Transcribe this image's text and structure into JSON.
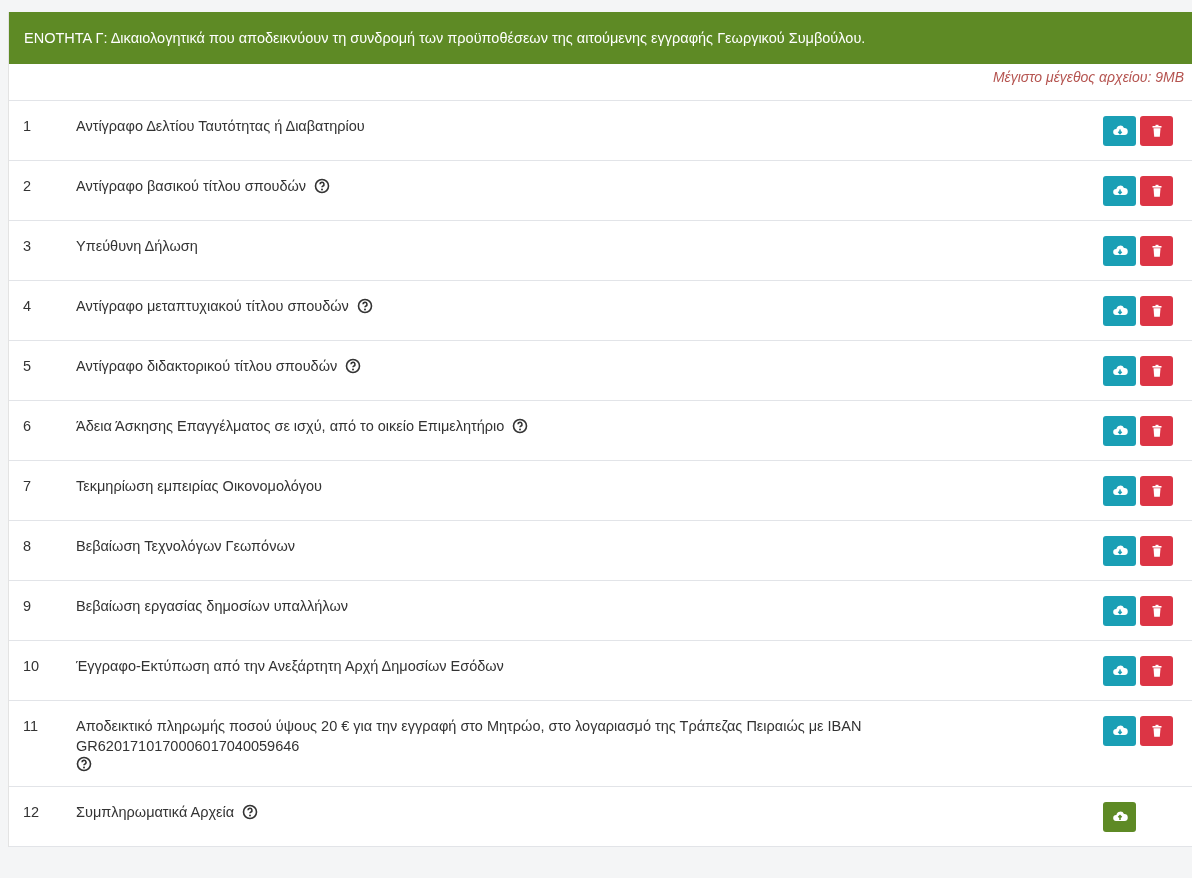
{
  "section": {
    "title": "ΕΝΟΤΗΤΑ Γ: Δικαιολογητικά που αποδεικνύουν τη συνδρομή των προϋποθέσεων της αιτούμενης εγγραφής Γεωργικού Συμβούλου.",
    "max_size_note": "Μέγιστο μέγεθος αρχείου: 9MB"
  },
  "documents": [
    {
      "number": "1",
      "label": "Αντίγραφο Δελτίου Ταυτότητας ή Διαβατηρίου",
      "help": false,
      "kind": "document"
    },
    {
      "number": "2",
      "label": "Αντίγραφο βασικού τίτλου σπουδών",
      "help": true,
      "kind": "document"
    },
    {
      "number": "3",
      "label": "Υπεύθυνη Δήλωση",
      "help": false,
      "kind": "document"
    },
    {
      "number": "4",
      "label": "Αντίγραφο μεταπτυχιακού τίτλου σπουδών",
      "help": true,
      "kind": "document"
    },
    {
      "number": "5",
      "label": "Αντίγραφο διδακτορικού τίτλου σπουδών",
      "help": true,
      "kind": "document"
    },
    {
      "number": "6",
      "label": "Άδεια Άσκησης Επαγγέλματος σε ισχύ, από το οικείο Επιμελητήριο",
      "help": true,
      "kind": "document"
    },
    {
      "number": "7",
      "label": "Τεκμηρίωση εμπειρίας Οικονομολόγου",
      "help": false,
      "kind": "document"
    },
    {
      "number": "8",
      "label": "Βεβαίωση Τεχνολόγων Γεωπόνων",
      "help": false,
      "kind": "document"
    },
    {
      "number": "9",
      "label": "Βεβαίωση εργασίας δημοσίων υπαλλήλων",
      "help": false,
      "kind": "document"
    },
    {
      "number": "10",
      "label": "Έγγραφο-Εκτύπωση από την Ανεξάρτητη Αρχή Δημοσίων Εσόδων",
      "help": false,
      "kind": "document"
    },
    {
      "number": "11",
      "label": "Αποδεικτικό πληρωμής ποσού ύψους 20 € για την εγγραφή στο Μητρώο, στο λογαριασμό της Τράπεζας Πειραιώς με IBAN GR6201710170006017040059646",
      "help": true,
      "kind": "document"
    },
    {
      "number": "12",
      "label": "Συμπληρωματικά Αρχεία",
      "help": true,
      "kind": "supplementary"
    }
  ]
}
